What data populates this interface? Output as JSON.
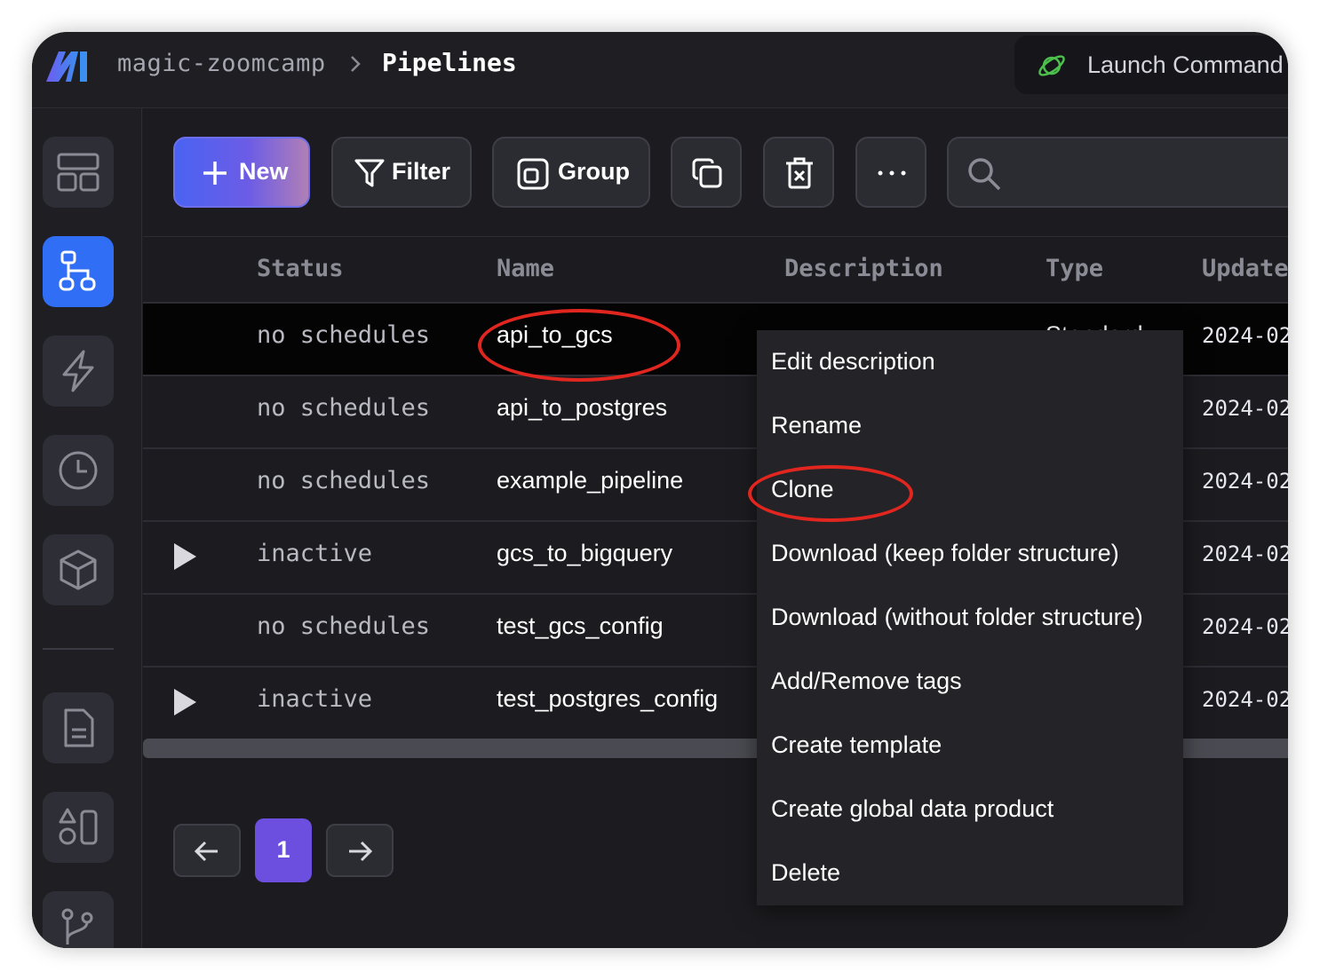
{
  "header": {
    "project": "magic-zoomcamp",
    "separator": ">",
    "page": "Pipelines",
    "launch_label": "Launch Command"
  },
  "sidebar": {
    "items": [
      {
        "name": "dashboard",
        "icon": "layout-icon",
        "active": false
      },
      {
        "name": "pipelines",
        "icon": "pipeline-icon",
        "active": true
      },
      {
        "name": "triggers",
        "icon": "lightning-icon",
        "active": false
      },
      {
        "name": "runs",
        "icon": "clock-icon",
        "active": false
      },
      {
        "name": "blocks",
        "icon": "cube-icon",
        "active": false
      },
      {
        "name": "files",
        "icon": "file-icon",
        "active": false
      },
      {
        "name": "templates",
        "icon": "shapes-icon",
        "active": false
      },
      {
        "name": "version-control",
        "icon": "git-branch-icon",
        "active": false
      }
    ]
  },
  "toolbar": {
    "new_label": "New",
    "filter_label": "Filter",
    "group_label": "Group",
    "search_placeholder": ""
  },
  "table": {
    "columns": [
      "Status",
      "Name",
      "Description",
      "Type",
      "Update"
    ],
    "rows": [
      {
        "status": "no schedules",
        "name": "api_to_gcs",
        "type": "Standard",
        "updated": "2024-02",
        "playable": false,
        "selected": true
      },
      {
        "status": "no schedules",
        "name": "api_to_postgres",
        "updated": "2024-02",
        "playable": false
      },
      {
        "status": "no schedules",
        "name": "example_pipeline",
        "updated": "2024-02",
        "playable": false
      },
      {
        "status": "inactive",
        "name": "gcs_to_bigquery",
        "updated": "2024-02",
        "playable": true
      },
      {
        "status": "no schedules",
        "name": "test_gcs_config",
        "updated": "2024-02",
        "playable": false
      },
      {
        "status": "inactive",
        "name": "test_postgres_config",
        "updated": "2024-02",
        "playable": true
      }
    ]
  },
  "pagination": {
    "current_page": "1"
  },
  "context_menu": {
    "items": [
      "Edit description",
      "Rename",
      "Clone",
      "Download (keep folder structure)",
      "Download (without folder structure)",
      "Add/Remove tags",
      "Create template",
      "Create global data product",
      "Delete"
    ]
  },
  "colors": {
    "accent": "#2f6ef5",
    "page_active": "#6c4fdf",
    "annotation": "#e0261f"
  }
}
